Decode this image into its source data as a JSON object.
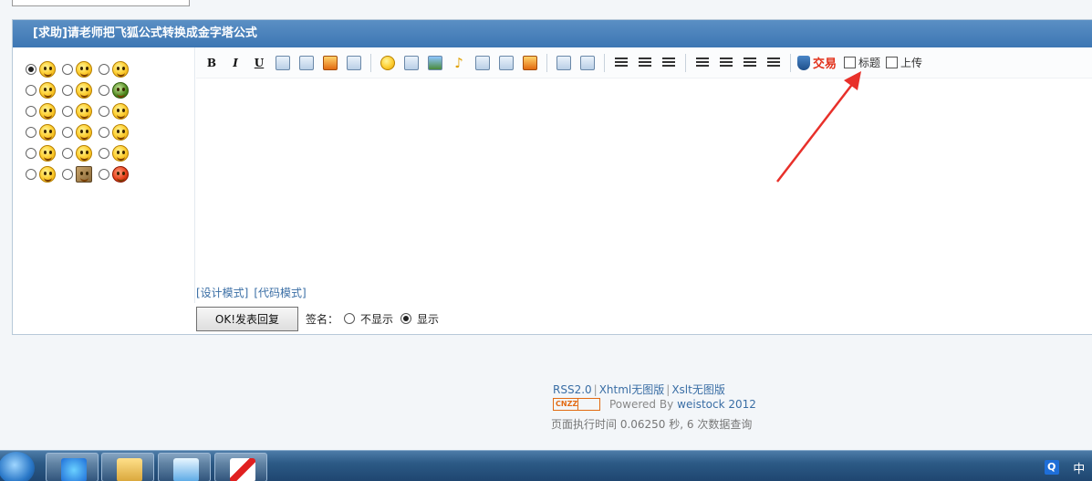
{
  "panel": {
    "title": "[求助]请老师把飞狐公式转换成金字塔公式"
  },
  "toolbar": {
    "bold": "B",
    "italic": "I",
    "underline": "U",
    "trade_label": "交易",
    "title_checkbox_label": "标题",
    "upload_checkbox_label": "上传"
  },
  "editor": {
    "design_mode": "[设计模式]",
    "code_mode": "[代码模式]"
  },
  "reply": {
    "submit_label": "OK!发表回复",
    "signature_label": "签名：",
    "hide_option": "不显示",
    "show_option": "显示"
  },
  "footer": {
    "rss": "RSS2.0",
    "xhtml": "Xhtml无图版",
    "xslt": "Xslt无图版",
    "cnzz": "CNZZ",
    "powered_prefix": "Powered By",
    "powered_link": "weistock 2012",
    "exec_info": "页面执行时间 0.06250 秒, 6 次数据查询"
  },
  "taskbar": {
    "tray_q": "Q",
    "tray_lang": "中"
  },
  "colors": {
    "header": "#3d76b3",
    "link": "#3a6ea5",
    "annotation_arrow": "#e8302a"
  }
}
